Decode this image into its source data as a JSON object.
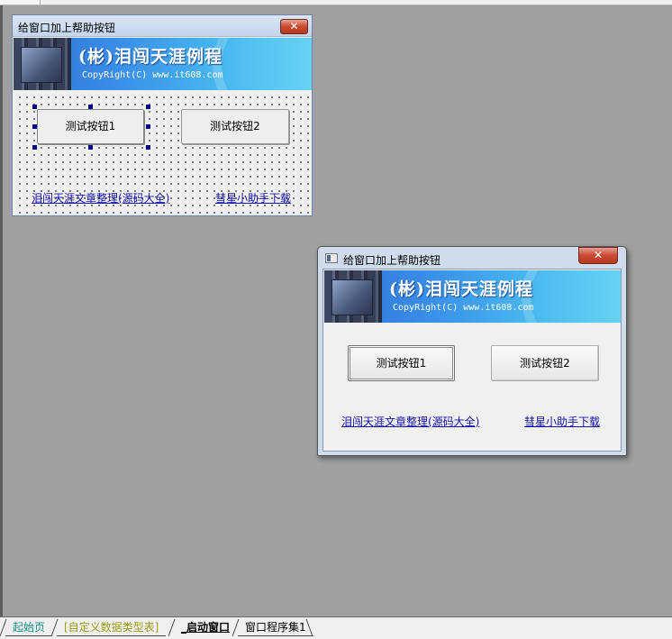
{
  "design_window": {
    "title": "给窗口加上帮助按钮",
    "close_glyph": "✕",
    "banner": {
      "title": "(彬)泪闯天涯例程",
      "copyright": "CopyRight(C) www.it608.com"
    },
    "button1": "测试按钮1",
    "button2": "测试按钮2",
    "link1": "泪闯天涯文章整理(源码大全)",
    "link2": "彗星小助手下载"
  },
  "run_window": {
    "title": "给窗口加上帮助按钮",
    "close_glyph": "✕",
    "banner": {
      "title": "(彬)泪闯天涯例程",
      "copyright": "CopyRight(C) www.it608.com"
    },
    "button1": "测试按钮1",
    "button2": "测试按钮2",
    "link1": "泪闯天涯文章整理(源码大全)",
    "link2": "彗星小助手下载"
  },
  "tabs": [
    {
      "label": "起始页"
    },
    {
      "label": "[自定义数据类型表]"
    },
    {
      "label": "_启动窗口"
    },
    {
      "label": "窗口程序集1"
    }
  ],
  "colors": {
    "workspace": "#a0a0a0",
    "link": "#1414a8",
    "selection_handle": "#00008b",
    "close_button": "#c84a30"
  }
}
